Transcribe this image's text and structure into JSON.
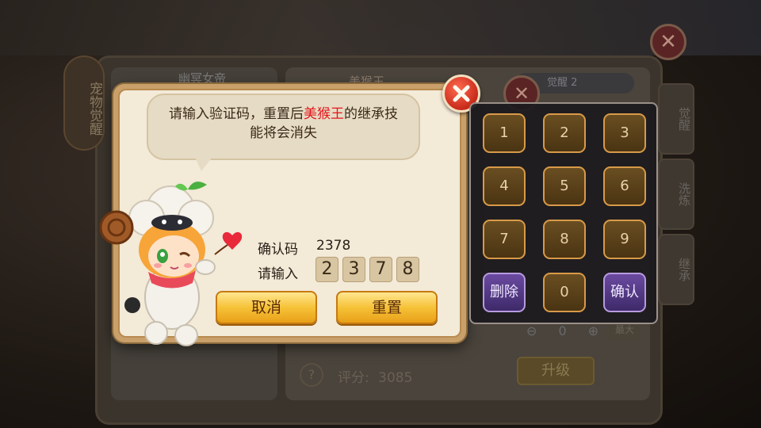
{
  "background": {
    "vertical_tab": "宠物觉醒",
    "left_name": "幽冥女帝",
    "mid_name": "美猴王",
    "top_tab": "觉醒 2",
    "side_tabs": [
      "觉醒",
      "洗炼",
      "继承"
    ],
    "score_label": "评分:",
    "score_value": "3085",
    "upgrade_label": "升级",
    "stepper_value": "0",
    "max_label": "最大",
    "help_glyph": "?",
    "close_glyph": "✕"
  },
  "dialog": {
    "message_prefix": "请输入验证码，重置后",
    "message_highlight": "美猴王",
    "message_suffix": "的继承技能将会消失",
    "confirm_code_label": "确认码",
    "confirm_code_value": "2378",
    "input_label": "请输入",
    "input_digits": [
      "2",
      "3",
      "7",
      "8"
    ],
    "cancel_label": "取消",
    "reset_label": "重置"
  },
  "keypad": {
    "keys": [
      "1",
      "2",
      "3",
      "4",
      "5",
      "6",
      "7",
      "8",
      "9"
    ],
    "delete_label": "删除",
    "zero_label": "0",
    "confirm_label": "确认"
  },
  "colors": {
    "highlight": "#e4161c",
    "button_yellow": "#f6c238",
    "close_red": "#c82a1a",
    "key_border": "#d89a48",
    "key_purple": "#6a4aa0"
  }
}
